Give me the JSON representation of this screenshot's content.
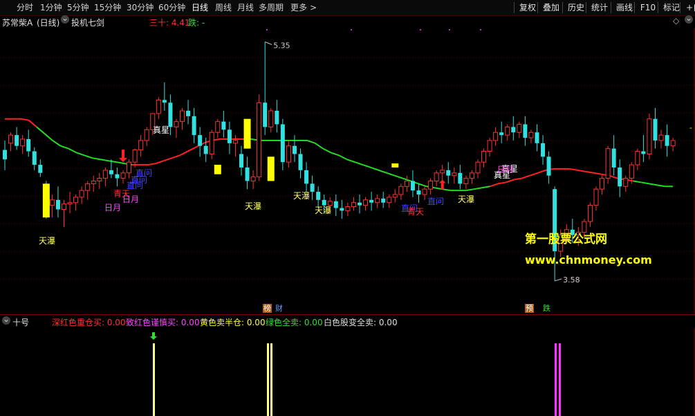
{
  "toolbar": {
    "periods": [
      "分时",
      "1分钟",
      "5分钟",
      "15分钟",
      "30分钟",
      "60分钟",
      "日线",
      "周线",
      "月线",
      "多周期",
      "更多"
    ],
    "active_period": "日线",
    "more_arrow": "chevron-right-icon",
    "right_buttons": [
      "复权",
      "叠加",
      "历史",
      "统计",
      "画线",
      "F10",
      "标记",
      "+自"
    ]
  },
  "infobar": {
    "stock": "苏常柴A",
    "period": "(日线)",
    "formula": "投机七剑",
    "ind1": "三十: 4.41",
    "ind2": "跌: -",
    "diamond_icon": "diamond-icon"
  },
  "chart_data": {
    "type": "candlestick",
    "price_high_label": "5.35",
    "price_low_label": "3.58",
    "ylim": [
      3.4,
      5.45
    ],
    "grid": true,
    "candles": [
      [
        4.55,
        4.62,
        4.48,
        4.4
      ],
      [
        4.6,
        4.68,
        4.66,
        4.54
      ],
      [
        4.66,
        4.72,
        4.58,
        4.55
      ],
      [
        4.58,
        4.66,
        4.63,
        4.52
      ],
      [
        4.63,
        4.7,
        4.54,
        4.5
      ],
      [
        4.54,
        4.57,
        4.44,
        4.4
      ],
      [
        4.44,
        4.48,
        4.38,
        4.35
      ],
      [
        4.3,
        4.32,
        4.13,
        4.04
      ],
      [
        4.14,
        4.22,
        4.18,
        4.05
      ],
      [
        4.18,
        4.28,
        4.11,
        4.05
      ],
      [
        4.11,
        4.18,
        4.15,
        3.98
      ],
      [
        4.15,
        4.24,
        4.16,
        4.08
      ],
      [
        4.16,
        4.22,
        4.2,
        4.1
      ],
      [
        4.2,
        4.28,
        4.25,
        4.15
      ],
      [
        4.25,
        4.32,
        4.3,
        4.18
      ],
      [
        4.3,
        4.36,
        4.32,
        4.24
      ],
      [
        4.32,
        4.38,
        4.34,
        4.26
      ],
      [
        4.34,
        4.42,
        4.4,
        4.28
      ],
      [
        4.4,
        4.48,
        4.37,
        4.34
      ],
      [
        4.37,
        4.42,
        4.34,
        4.28
      ],
      [
        4.34,
        4.4,
        4.38,
        4.3
      ],
      [
        4.38,
        4.48,
        4.46,
        4.34
      ],
      [
        4.46,
        4.56,
        4.55,
        4.42
      ],
      [
        4.55,
        4.66,
        4.62,
        4.5
      ],
      [
        4.62,
        4.72,
        4.7,
        4.58
      ],
      [
        4.7,
        4.82,
        4.82,
        4.66
      ],
      [
        4.82,
        4.94,
        4.92,
        4.78
      ],
      [
        4.92,
        5.05,
        4.9,
        4.84
      ],
      [
        4.9,
        4.96,
        4.72,
        4.66
      ],
      [
        4.72,
        4.78,
        4.76,
        4.64
      ],
      [
        4.76,
        4.86,
        4.84,
        4.7
      ],
      [
        4.84,
        4.92,
        4.8,
        4.74
      ],
      [
        4.8,
        4.86,
        4.66,
        4.6
      ],
      [
        4.66,
        4.72,
        4.58,
        4.5
      ],
      [
        4.58,
        4.64,
        4.52,
        4.46
      ],
      [
        4.52,
        4.7,
        4.68,
        4.48
      ],
      [
        4.68,
        4.78,
        4.76,
        4.64
      ],
      [
        4.76,
        4.84,
        4.7,
        4.64
      ],
      [
        4.7,
        4.76,
        4.6,
        4.52
      ],
      [
        4.6,
        4.66,
        4.62,
        4.5
      ],
      [
        4.52,
        4.58,
        4.42,
        4.36
      ],
      [
        4.42,
        4.5,
        4.32,
        4.26
      ],
      [
        4.32,
        4.4,
        4.35,
        4.26
      ],
      [
        4.35,
        4.96,
        4.9,
        4.32
      ],
      [
        4.9,
        5.35,
        4.72,
        4.66
      ],
      [
        4.72,
        4.86,
        4.84,
        4.68
      ],
      [
        4.84,
        4.92,
        4.74,
        4.68
      ],
      [
        4.74,
        4.78,
        4.46,
        4.4
      ],
      [
        4.46,
        4.62,
        4.58,
        4.42
      ],
      [
        4.58,
        4.66,
        4.52,
        4.46
      ],
      [
        4.52,
        4.56,
        4.4,
        4.34
      ],
      [
        4.4,
        4.46,
        4.3,
        4.24
      ],
      [
        4.3,
        4.36,
        4.24,
        4.18
      ],
      [
        4.24,
        4.28,
        4.18,
        4.12
      ],
      [
        4.18,
        4.22,
        4.14,
        4.08
      ],
      [
        4.14,
        4.2,
        4.17,
        4.08
      ],
      [
        4.17,
        4.22,
        4.12,
        4.06
      ],
      [
        4.12,
        4.18,
        4.1,
        4.04
      ],
      [
        4.1,
        4.16,
        4.13,
        4.06
      ],
      [
        4.13,
        4.2,
        4.16,
        4.1
      ],
      [
        4.16,
        4.22,
        4.14,
        4.08
      ],
      [
        4.14,
        4.2,
        4.18,
        4.1
      ],
      [
        4.18,
        4.24,
        4.16,
        4.1
      ],
      [
        4.16,
        4.22,
        4.19,
        4.12
      ],
      [
        4.19,
        4.24,
        4.16,
        4.12
      ],
      [
        4.16,
        4.22,
        4.2,
        4.12
      ],
      [
        4.2,
        4.26,
        4.22,
        4.16
      ],
      [
        4.22,
        4.3,
        4.28,
        4.18
      ],
      [
        4.28,
        4.36,
        4.32,
        4.24
      ],
      [
        4.32,
        4.4,
        4.25,
        4.2
      ],
      [
        4.25,
        4.3,
        4.22,
        4.16
      ],
      [
        4.22,
        4.28,
        4.26,
        4.18
      ],
      [
        4.26,
        4.34,
        4.32,
        4.22
      ],
      [
        4.32,
        4.4,
        4.38,
        4.28
      ],
      [
        4.38,
        4.44,
        4.4,
        4.3
      ],
      [
        4.4,
        4.46,
        4.36,
        4.3
      ],
      [
        4.36,
        4.42,
        4.38,
        4.3
      ],
      [
        4.38,
        4.44,
        4.3,
        4.26
      ],
      [
        4.3,
        4.36,
        4.34,
        4.26
      ],
      [
        4.34,
        4.4,
        4.38,
        4.3
      ],
      [
        4.38,
        4.48,
        4.46,
        4.34
      ],
      [
        4.46,
        4.56,
        4.54,
        4.42
      ],
      [
        4.54,
        4.64,
        4.62,
        4.5
      ],
      [
        4.62,
        4.72,
        4.68,
        4.58
      ],
      [
        4.68,
        4.76,
        4.66,
        4.6
      ],
      [
        4.66,
        4.74,
        4.72,
        4.62
      ],
      [
        4.72,
        4.8,
        4.68,
        4.62
      ],
      [
        4.68,
        4.76,
        4.74,
        4.64
      ],
      [
        4.74,
        4.8,
        4.64,
        4.58
      ],
      [
        4.64,
        4.7,
        4.68,
        4.6
      ],
      [
        4.68,
        4.74,
        4.6,
        4.54
      ],
      [
        4.6,
        4.66,
        4.5,
        4.44
      ],
      [
        4.5,
        4.54,
        4.36,
        4.3
      ],
      [
        4.26,
        4.28,
        3.8,
        3.58
      ],
      [
        3.8,
        3.96,
        3.92,
        3.76
      ],
      [
        3.92,
        4.0,
        3.96,
        3.86
      ],
      [
        3.96,
        4.04,
        3.92,
        3.86
      ],
      [
        3.92,
        3.98,
        3.94,
        3.84
      ],
      [
        3.94,
        4.04,
        4.02,
        3.9
      ],
      [
        4.02,
        4.16,
        4.14,
        3.98
      ],
      [
        4.14,
        4.28,
        4.26,
        4.1
      ],
      [
        4.26,
        4.36,
        4.34,
        4.22
      ],
      [
        4.34,
        4.58,
        4.56,
        4.3
      ],
      [
        4.56,
        4.66,
        4.42,
        4.36
      ],
      [
        4.42,
        4.48,
        4.28,
        4.2
      ],
      [
        4.28,
        4.36,
        4.34,
        4.24
      ],
      [
        4.34,
        4.46,
        4.44,
        4.3
      ],
      [
        4.44,
        4.56,
        4.54,
        4.4
      ],
      [
        4.54,
        4.66,
        4.52,
        4.46
      ],
      [
        4.52,
        4.82,
        4.78,
        4.48
      ],
      [
        4.78,
        4.86,
        4.62,
        4.56
      ],
      [
        4.62,
        4.7,
        4.66,
        4.56
      ],
      [
        4.66,
        4.74,
        4.58,
        4.5
      ],
      [
        4.58,
        4.64,
        4.62,
        4.54
      ]
    ],
    "yellow_blocks": [
      [
        7,
        4.3,
        4.05
      ],
      [
        36,
        4.44,
        4.37
      ],
      [
        41,
        4.78,
        4.56
      ],
      [
        45,
        4.5,
        4.32
      ],
      [
        66,
        4.45,
        4.42
      ]
    ],
    "ma_line": [
      4.78,
      4.78,
      4.78,
      4.77,
      4.72,
      4.67,
      4.62,
      4.58,
      4.56,
      4.53,
      4.51,
      4.49,
      4.48,
      4.47,
      4.46,
      4.45,
      4.44,
      4.44,
      4.44,
      4.45,
      4.47,
      4.49,
      4.51,
      4.54,
      4.57,
      4.6,
      4.62,
      4.63,
      4.63,
      4.63,
      4.63,
      4.63,
      4.62,
      4.62,
      4.62,
      4.62,
      4.62,
      4.62,
      4.62,
      4.6,
      4.56,
      4.53,
      4.51,
      4.48,
      4.46,
      4.44,
      4.42,
      4.4,
      4.38,
      4.36,
      4.34,
      4.32,
      4.3,
      4.28,
      4.27,
      4.26,
      4.25,
      4.25,
      4.25,
      4.26,
      4.27,
      4.28,
      4.3,
      4.31,
      4.33,
      4.34,
      4.36,
      4.38,
      4.4,
      4.41,
      4.41,
      4.41,
      4.4,
      4.39,
      4.38,
      4.37,
      4.36,
      4.34,
      4.33,
      4.32,
      4.31,
      4.3,
      4.29,
      4.28,
      4.28
    ],
    "ma_red_ranges": [
      [
        0,
        5
      ],
      [
        17,
        31
      ],
      [
        62,
        80
      ],
      [
        85,
        111
      ]
    ],
    "arrows_down": [
      [
        20,
        4.46
      ]
    ],
    "arrows_up": [
      [
        74,
        4.33
      ]
    ]
  },
  "annotations": [
    {
      "text": "天瀑",
      "color": "#ffff66"
    },
    {
      "text": "日月",
      "color": "#ff44ff"
    },
    {
      "text": "青天",
      "color": "#ff3333"
    },
    {
      "text": "日月",
      "color": "#ff44ff"
    },
    {
      "text": "直问",
      "color": "#4444ff"
    },
    {
      "text": "直问",
      "color": "#4444ff"
    },
    {
      "text": "直问",
      "color": "#4444ff"
    },
    {
      "text": "真星",
      "color": "#ffffff"
    },
    {
      "text": "天瀑",
      "color": "#ffff66"
    },
    {
      "text": "天瀑",
      "color": "#ffff66"
    },
    {
      "text": "天瀑",
      "color": "#ffff66"
    },
    {
      "text": "直问",
      "color": "#4444ff"
    },
    {
      "text": "青天",
      "color": "#ff3333"
    },
    {
      "text": "直问",
      "color": "#4444ff"
    },
    {
      "text": "天瀑",
      "color": "#ffff66"
    },
    {
      "text": "真星",
      "color": "#ffffff"
    },
    {
      "text": "真星",
      "color": "#ffffff"
    },
    {
      "text": "日月",
      "color": "#ff44ff"
    }
  ],
  "bottom_tags": [
    {
      "text": "榜",
      "bg": "#b05a1a",
      "color": "#ffffff"
    },
    {
      "text": "财",
      "bg": "#000000",
      "color": "#6699ff"
    },
    {
      "text": "预",
      "bg": "#b05a1a",
      "color": "#ffffff"
    },
    {
      "text": "跌",
      "bg": "#000000",
      "color": "#33dd33"
    }
  ],
  "watermark": {
    "line1": "第一股票公式网",
    "line2": "www.chnmoney.com",
    "color": "#ffff00"
  },
  "indicator_panel": {
    "name": "十号",
    "items": [
      {
        "label": "深红色重仓买:",
        "value": "0.00",
        "color": "#ff3333"
      },
      {
        "label": "致红色谨慎买:",
        "value": "0.00",
        "color": "#ff44ff"
      },
      {
        "label": "黄色卖半仓:",
        "value": "0.00",
        "color": "#ffff33"
      },
      {
        "label": "绿色全卖:",
        "value": "0.00",
        "color": "#33dd33"
      },
      {
        "label": "白色股变全卖:",
        "value": "0.00",
        "color": "#dddddd"
      }
    ]
  },
  "signals": {
    "bars": [
      {
        "color": "#ffff88",
        "strength": 1
      },
      {
        "color": "#ffff88",
        "strength": 1
      },
      {
        "color": "#ffff88",
        "strength": 1
      },
      {
        "color": "#ff33ff",
        "strength": 1
      },
      {
        "color": "#ff33ff",
        "strength": 1
      }
    ],
    "marker_color": "#33dd33"
  },
  "colors": {
    "up": "#ff3333",
    "down": "#33e0e0",
    "grid": "#5a0000",
    "ma_up": "#ff2222",
    "ma_down": "#22dd22"
  }
}
